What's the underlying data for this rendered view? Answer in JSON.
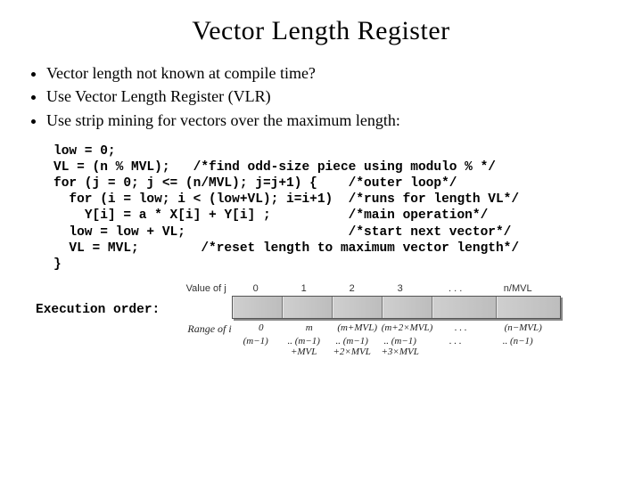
{
  "title": "Vector Length Register",
  "bullets": [
    "Vector length not known at compile time?",
    "Use Vector Length Register (VLR)",
    "Use strip mining for vectors over the maximum length:"
  ],
  "code": "low = 0;\nVL = (n % MVL);   /*find odd-size piece using modulo % */\nfor (j = 0; j <= (n/MVL); j=j+1) {    /*outer loop*/\n  for (i = low; i < (low+VL); i=i+1)  /*runs for length VL*/\n    Y[i] = a * X[i] + Y[i] ;          /*main operation*/\n  low = low + VL;                     /*start next vector*/\n  VL = MVL;        /*reset length to maximum vector length*/\n}",
  "exec_label": "Execution order:",
  "diagram": {
    "j_label": "Value of j",
    "j_values": [
      "0",
      "1",
      "2",
      "3",
      ". . .",
      "n/MVL"
    ],
    "range_label": "Range of i",
    "range_top": [
      "0",
      "m",
      "(m+MVL)",
      "(m+2×MVL)",
      ". . .",
      "(n−MVL)"
    ],
    "range_bot_lead": "..",
    "range_bot": [
      "(m−1)",
      "..\n(m−1)\n+MVL",
      "..\n(m−1)\n+2×MVL",
      "..\n(m−1)\n+3×MVL",
      ". . .",
      "..\n(n−1)"
    ]
  }
}
